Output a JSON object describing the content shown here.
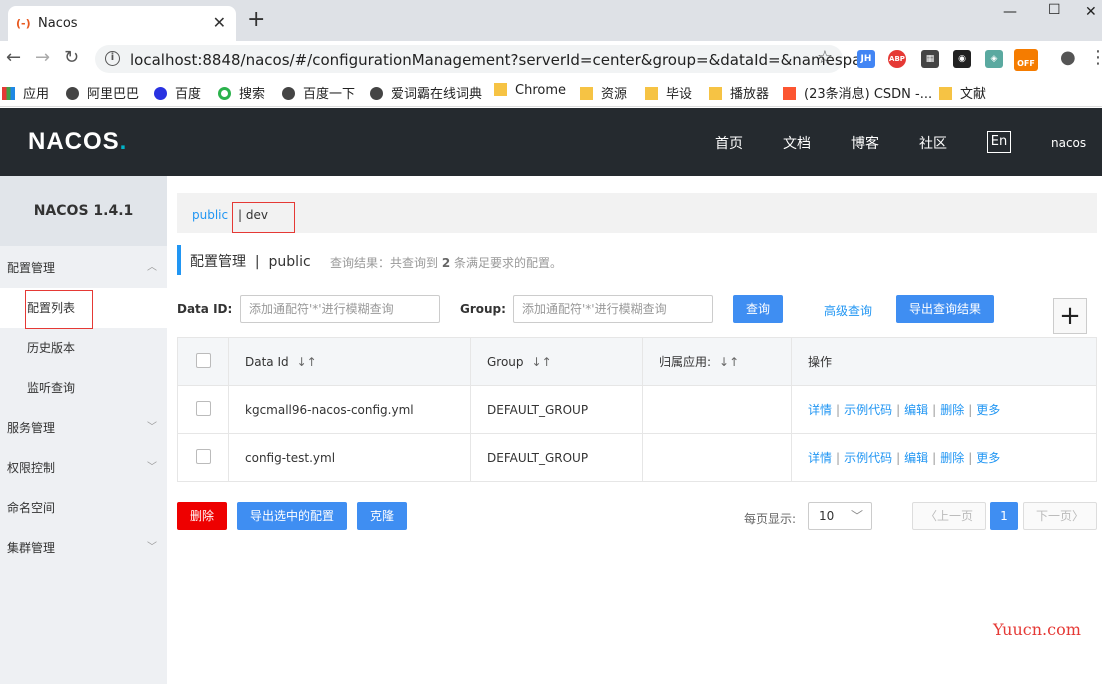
{
  "browser": {
    "tab_title": "Nacos",
    "tab_favicon": "(-)",
    "url": "localhost:8848/nacos/#/configurationManagement?serverId=center&group=&dataId=&namespa...",
    "bookmarks": [
      "应用",
      "阿里巴巴",
      "百度",
      "搜索",
      "百度一下",
      "爱词霸在线词典",
      "Chrome",
      "资源",
      "毕设",
      "播放器",
      "(23条消息) CSDN -...",
      "文献"
    ]
  },
  "extensions": {
    "jh": "JH",
    "abp": "ABP",
    "off": "OFF"
  },
  "header": {
    "logo_main": "NACOS",
    "logo_dot": ".",
    "nav": [
      "首页",
      "文档",
      "博客",
      "社区"
    ],
    "lang": "En",
    "user": "nacos"
  },
  "sidebar": {
    "version": "NACOS 1.4.1",
    "items": [
      "配置管理",
      "配置列表",
      "历史版本",
      "监听查询",
      "服务管理",
      "权限控制",
      "命名空间",
      "集群管理"
    ]
  },
  "namespace": {
    "public": "public",
    "dev": "| dev"
  },
  "title": {
    "main": "配置管理",
    "sep": "|",
    "ns": "public",
    "hint_prefix": "查询结果：共查询到",
    "hint_count": "2",
    "hint_suffix": "条满足要求的配置。"
  },
  "filter": {
    "dataid_label": "Data ID:",
    "dataid_placeholder": "添加通配符'*'进行模糊查询",
    "group_label": "Group:",
    "group_placeholder": "添加通配符'*'进行模糊查询",
    "query": "查询",
    "advanced": "高级查询",
    "export": "导出查询结果",
    "plus": "+"
  },
  "table": {
    "headers": [
      "Data Id",
      "Group",
      "归属应用:",
      "操作"
    ],
    "sort_icon": "↓↑",
    "rows": [
      {
        "dataId": "kgcmall96-nacos-config.yml",
        "group": "DEFAULT_GROUP",
        "app": ""
      },
      {
        "dataId": "config-test.yml",
        "group": "DEFAULT_GROUP",
        "app": ""
      }
    ],
    "ops": [
      "详情",
      "示例代码",
      "编辑",
      "删除",
      "更多"
    ],
    "op_sep": "|"
  },
  "actions": {
    "delete": "删除",
    "export_selected": "导出选中的配置",
    "clone": "克隆"
  },
  "pager": {
    "label": "每页显示:",
    "size": "10",
    "prev": "上一页",
    "current": "1",
    "next": "下一页"
  },
  "watermark": "Yuucn.com",
  "colors": {
    "header_bg": "#252a2f",
    "accent": "#2196f3",
    "primary_btn": "#3f8ef2",
    "danger_btn": "#ee0000",
    "highlight_box": "#e53935"
  }
}
